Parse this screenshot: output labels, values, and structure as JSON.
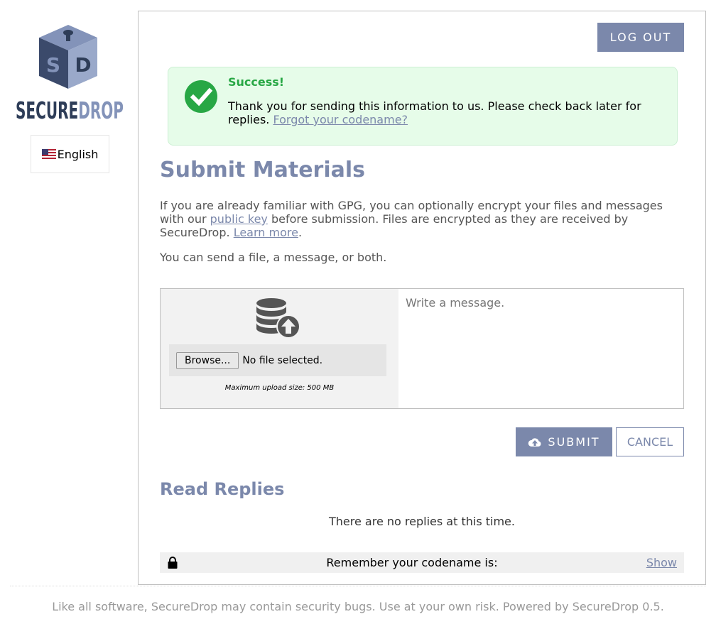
{
  "brand": {
    "logo_letters": [
      "S",
      "D"
    ],
    "logo_wordmark_1": "SECURE",
    "logo_wordmark_2": "DROP"
  },
  "language": {
    "label": "English",
    "flag_icon": "us-flag-icon"
  },
  "header": {
    "logout_label": "LOG OUT"
  },
  "success": {
    "title": "Success!",
    "message": "Thank you for sending this information to us. Please check back later for replies.",
    "link": "Forgot your codename?",
    "icon": "checkmark-circle-icon",
    "accent": "#28a745"
  },
  "submit": {
    "title": "Submit Materials",
    "intro_1": "If you are already familiar with GPG, you can optionally encrypt your files and messages with our",
    "public_key_link": "public key",
    "intro_2": "before submission. Files are encrypted as they are received by SecureDrop.",
    "learn_more_link": "Learn more",
    "intro_end": ".",
    "send_note": "You can send a file, a message, or both.",
    "upload_icon": "database-upload-icon",
    "browse_label": "Browse...",
    "file_status": "No file selected.",
    "max_size": "Maximum upload size: 500 MB",
    "message_placeholder": "Write a message.",
    "submit_label": "SUBMIT",
    "submit_icon": "cloud-upload-icon",
    "cancel_label": "CANCEL"
  },
  "replies": {
    "title": "Read Replies",
    "empty": "There are no replies at this time.",
    "codename_label": "Remember your codename is:",
    "show_link": "Show",
    "lock_icon": "lock-icon"
  },
  "footer": {
    "text": "Like all software, SecureDrop may contain security bugs. Use at your own risk. Powered by SecureDrop 0.5."
  },
  "colors": {
    "accent": "#7b88ab",
    "success_bg": "#e6fce9",
    "logo_dark": "#2e3d58",
    "logo_light": "#8393b9"
  }
}
